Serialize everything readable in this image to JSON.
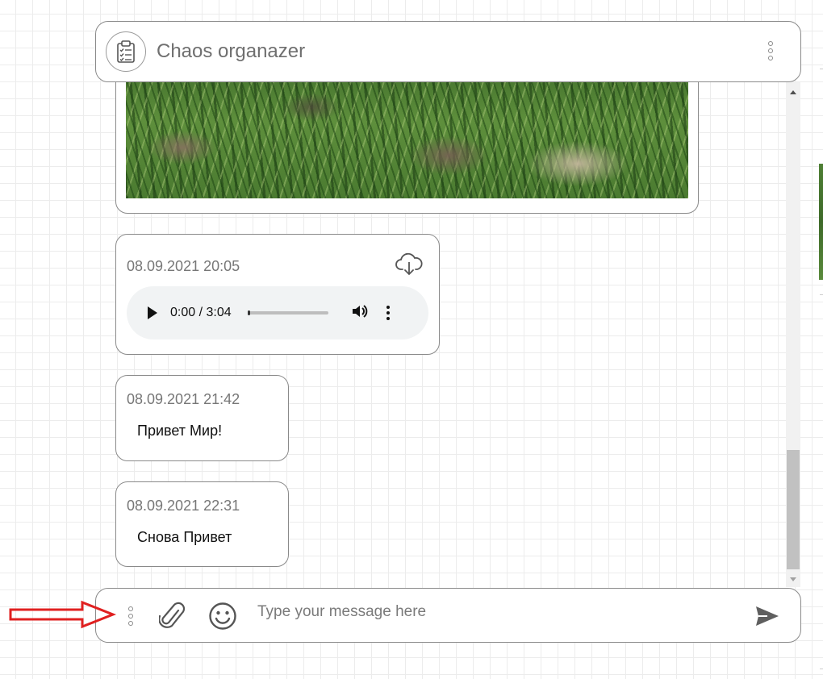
{
  "header": {
    "title": "Chaos organazer",
    "logo_icon": "clipboard-checklist-icon",
    "menu_icon": "more-vertical-icon"
  },
  "messages": [
    {
      "type": "image",
      "media": "grass-photo"
    },
    {
      "type": "audio",
      "timestamp": "08.09.2021 20:05",
      "download_icon": "cloud-download-icon",
      "player": {
        "time": "0:00 / 3:04",
        "progress": 0.0
      }
    },
    {
      "type": "text",
      "timestamp": "08.09.2021 21:42",
      "text": "Привет Мир!"
    },
    {
      "type": "text",
      "timestamp": "08.09.2021 22:31",
      "text": "Снова Привет"
    }
  ],
  "composer": {
    "placeholder": "Type your message here",
    "value": "",
    "menu_icon": "more-vertical-icon",
    "attach_icon": "paperclip-icon",
    "emoji_icon": "smiley-icon",
    "send_icon": "send-icon"
  },
  "annotation": {
    "icon": "red-arrow-icon",
    "color": "#e02020"
  },
  "colors": {
    "border": "#8a8a8a",
    "player_bg": "#f1f3f4",
    "text_muted": "#777777",
    "annotation": "#e02020"
  }
}
